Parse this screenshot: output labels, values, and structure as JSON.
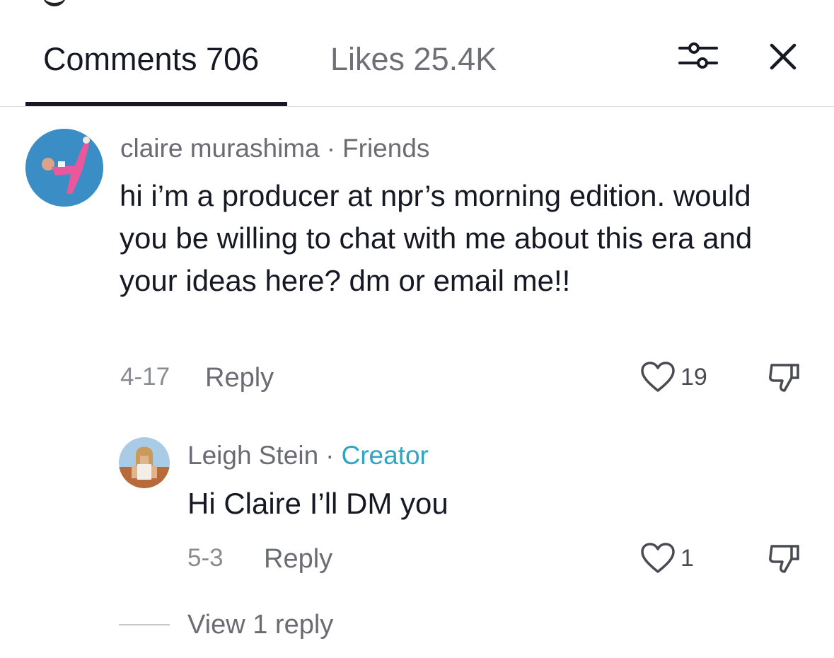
{
  "header": {
    "tabs": [
      {
        "label": "Comments 706",
        "active": true
      },
      {
        "label": "Likes 25.4K",
        "active": false
      }
    ],
    "icons": [
      "filter-icon",
      "close-icon"
    ]
  },
  "comments": [
    {
      "author": "claire murashima",
      "relation": "Friends",
      "text": "hi i’m a producer at npr’s morning edition. would you be willing to chat with me about this era and your ideas here? dm or email me!!",
      "date": "4-17",
      "reply_label": "Reply",
      "likes": "19"
    }
  ],
  "replies": [
    {
      "author": "Leigh Stein",
      "tag": "Creator",
      "text": "Hi Claire I’ll DM you",
      "date": "5-3",
      "reply_label": "Reply",
      "likes": "1"
    }
  ],
  "view_more": "View 1 reply",
  "colors": {
    "text": "#161823",
    "muted": "#6b6b73",
    "creator": "#2fa5c6",
    "divider": "#dedede"
  }
}
